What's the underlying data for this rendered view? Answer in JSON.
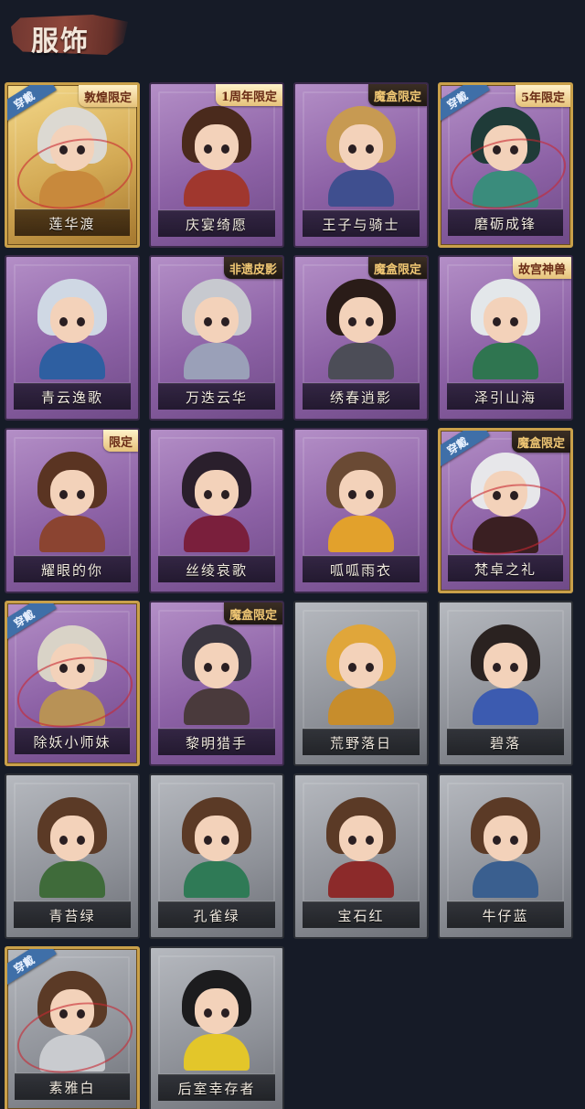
{
  "header": {
    "title": "服饰"
  },
  "worn_label": "穿戴",
  "colors": {
    "background": "#161b27",
    "worn_badge": "#3f6fa8",
    "equipped_border": "#c9a04a"
  },
  "costumes": [
    {
      "name": "莲华渡",
      "rarity": "gold",
      "badge": "敦煌限定",
      "worn": true,
      "hair": "#dcd9d2",
      "body": "#c8893c"
    },
    {
      "name": "庆宴绮愿",
      "rarity": "purple",
      "badge": "1周年限定",
      "worn": false,
      "hair": "#4a2a1c",
      "body": "#a0372e"
    },
    {
      "name": "王子与骑士",
      "rarity": "purple",
      "badge": "魔盒限定",
      "worn": false,
      "hair": "#c79a52",
      "body": "#3f4f8f"
    },
    {
      "name": "磨砺成锋",
      "rarity": "purple",
      "badge": "5年限定",
      "worn": true,
      "hair": "#1f3b38",
      "body": "#3a8c7c"
    },
    {
      "name": "青云逸歌",
      "rarity": "purple",
      "badge": "",
      "worn": false,
      "hair": "#cfd8e4",
      "body": "#2e5fa1"
    },
    {
      "name": "万迭云华",
      "rarity": "purple",
      "badge": "非遗皮影",
      "worn": false,
      "hair": "#c7c9cf",
      "body": "#9aa0b8"
    },
    {
      "name": "绣春逍影",
      "rarity": "purple",
      "badge": "魔盒限定",
      "worn": false,
      "hair": "#2a1c18",
      "body": "#4c4d57"
    },
    {
      "name": "泽引山海",
      "rarity": "purple",
      "badge": "故宫神兽",
      "worn": false,
      "hair": "#e3e7ea",
      "body": "#2f7550"
    },
    {
      "name": "耀眼的你",
      "rarity": "purple",
      "badge": "限定",
      "worn": false,
      "hair": "#5a3422",
      "body": "#8b4431"
    },
    {
      "name": "丝绫哀歌",
      "rarity": "purple",
      "badge": "",
      "worn": false,
      "hair": "#2a1f2c",
      "body": "#7a1f3c"
    },
    {
      "name": "呱呱雨衣",
      "rarity": "purple",
      "badge": "",
      "worn": false,
      "hair": "#6a4a34",
      "body": "#e2a12c"
    },
    {
      "name": "梵卓之礼",
      "rarity": "purple",
      "badge": "魔盒限定",
      "worn": true,
      "hair": "#e7e7ea",
      "body": "#3a1f22"
    },
    {
      "name": "除妖小师妹",
      "rarity": "purple",
      "badge": "",
      "worn": true,
      "hair": "#d9d3c7",
      "body": "#b89256"
    },
    {
      "name": "黎明猎手",
      "rarity": "purple",
      "badge": "魔盒限定",
      "worn": false,
      "hair": "#3a3640",
      "body": "#4a3a3c"
    },
    {
      "name": "荒野落日",
      "rarity": "gray",
      "badge": "",
      "worn": false,
      "hair": "#e0a63a",
      "body": "#c78d2c"
    },
    {
      "name": "碧落",
      "rarity": "gray",
      "badge": "",
      "worn": false,
      "hair": "#2a2220",
      "body": "#3c5bb0"
    },
    {
      "name": "青苔绿",
      "rarity": "gray",
      "badge": "",
      "worn": false,
      "hair": "#5b3a26",
      "body": "#3f6b3a"
    },
    {
      "name": "孔雀绿",
      "rarity": "gray",
      "badge": "",
      "worn": false,
      "hair": "#5b3a26",
      "body": "#2f7a56"
    },
    {
      "name": "宝石红",
      "rarity": "gray",
      "badge": "",
      "worn": false,
      "hair": "#5b3a26",
      "body": "#8c2a2a"
    },
    {
      "name": "牛仔蓝",
      "rarity": "gray",
      "badge": "",
      "worn": false,
      "hair": "#5b3a26",
      "body": "#3a5f8f"
    },
    {
      "name": "素雅白",
      "rarity": "gray",
      "badge": "",
      "worn": true,
      "hair": "#5b3a26",
      "body": "#c9cbcf"
    },
    {
      "name": "后室幸存者",
      "rarity": "gray",
      "badge": "",
      "worn": false,
      "hair": "#1c1c1e",
      "body": "#e3c62a"
    }
  ]
}
